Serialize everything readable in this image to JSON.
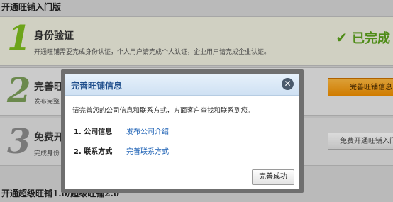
{
  "page": {
    "section_title": "开通旺铺入门版",
    "bottom_title": "开通超级旺铺1.0/超级旺铺2.0"
  },
  "steps": [
    {
      "number": "1",
      "title": "身份验证",
      "desc": "开通旺铺需要完成身份认证，个人用户请完成个人认证，企业用户请完成企业认证。",
      "status_icon": "check-icon",
      "status_text": "已完成"
    },
    {
      "number": "2",
      "title": "完善旺",
      "desc": "发布完整",
      "button": "完善旺铺信息"
    },
    {
      "number": "3",
      "title": "免费开",
      "desc": "完成身份",
      "button": "免费开通旺铺入门"
    }
  ],
  "modal": {
    "title": "完善旺铺信息",
    "close_icon": "close-icon",
    "close": "✕",
    "description": "请完善您的公司信息和联系方式，方面客户查找和联系到您。",
    "rows": [
      {
        "label": "1. 公司信息",
        "link": "发布公司介绍"
      },
      {
        "label": "2. 联系方式",
        "link": "完善联系方式"
      }
    ],
    "confirm": "完善成功"
  },
  "colors": {
    "accent_green": "#5aa01c",
    "orange_button": "#f59f1e",
    "link_blue": "#1a5fb4",
    "modal_title_blue": "#1e4e8c"
  }
}
